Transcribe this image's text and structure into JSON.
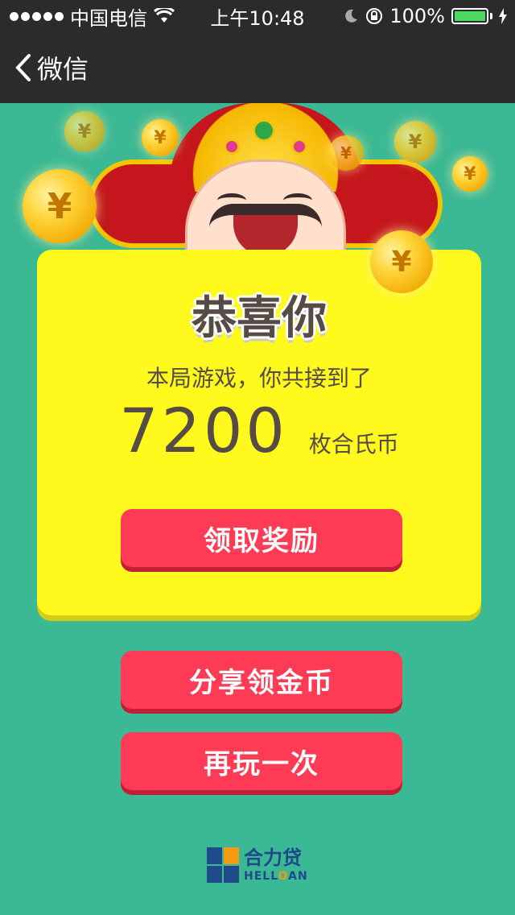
{
  "status_bar": {
    "carrier": "中国电信",
    "time": "上午10:48",
    "battery": "100%"
  },
  "nav": {
    "back_label": "微信"
  },
  "result": {
    "title": "恭喜你",
    "subtitle": "本局游戏，你共接到了",
    "score": "7200",
    "unit": "枚合氏币"
  },
  "buttons": {
    "claim": "领取奖励",
    "share": "分享领金币",
    "replay": "再玩一次"
  },
  "logo": {
    "cn": "合力贷",
    "en_prefix": "HELL",
    "en_o": "O",
    "en_suffix": "AN"
  },
  "colors": {
    "background": "#3bb894",
    "card": "#fff91e",
    "button": "#ff3b55",
    "bar": "#2b2b2b"
  },
  "icons": {
    "coin_symbol": "¥"
  }
}
